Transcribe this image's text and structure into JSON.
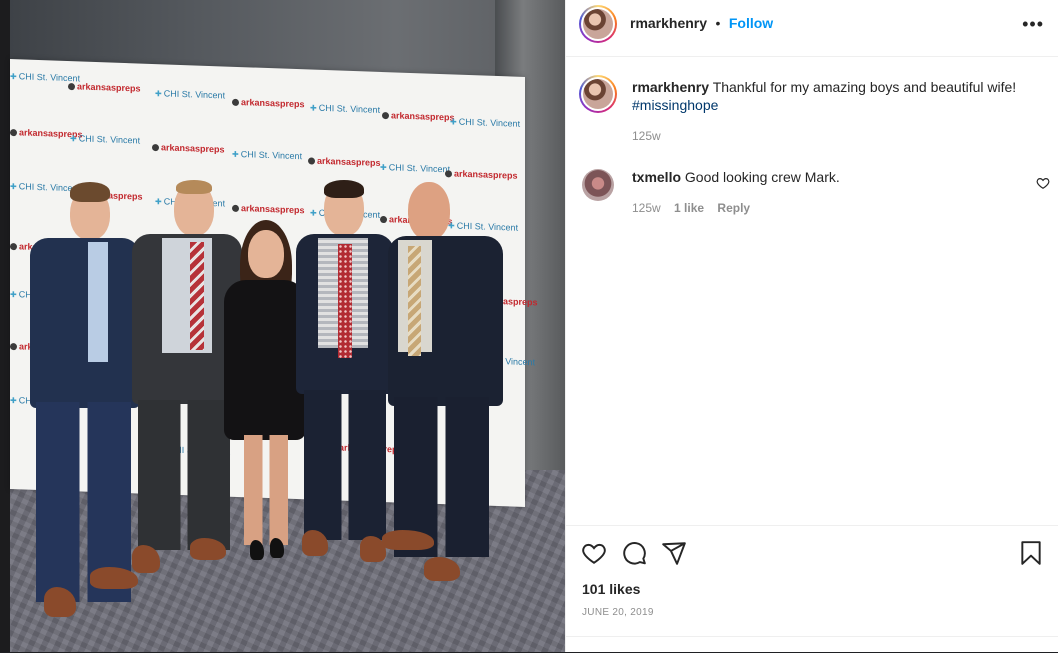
{
  "post": {
    "author": "rmarkhenry",
    "separator": "•",
    "follow_label": "Follow",
    "more_icon": "more-horizontal-icon",
    "caption_text": "Thankful for my amazing boys and beautiful wife!",
    "hashtag": "#missinghope",
    "caption_age": "125w",
    "likes": "101 likes",
    "date": "JUNE 20, 2019"
  },
  "comments": [
    {
      "user": "txmello",
      "text": "Good looking crew Mark.",
      "age": "125w",
      "likes": "1 like",
      "reply_label": "Reply"
    }
  ],
  "photo": {
    "backdrop_logos": [
      "arkansaspreps",
      "CHI St. Vincent"
    ]
  },
  "colors": {
    "accent": "#0095f6",
    "hashtag": "#00376b",
    "muted": "#8e8e8e",
    "text": "#262626",
    "brand_red": "#c2272d"
  },
  "icons": [
    "heart-icon",
    "comment-icon",
    "share-icon",
    "bookmark-icon",
    "heart-small-icon"
  ]
}
